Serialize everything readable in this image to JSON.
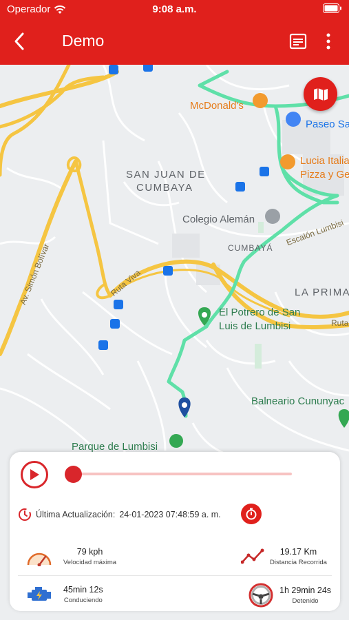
{
  "statusbar": {
    "carrier": "Operador",
    "time": "9:08 a.m."
  },
  "header": {
    "title": "Demo"
  },
  "map": {
    "labels": {
      "mcdonalds": "McDonald's",
      "paseo": "Paseo Sa",
      "lucia_1": "Lucia Italia",
      "lucia_2": "Pizza y Ge",
      "san_juan_1": "SAN JUAN DE",
      "san_juan_2": "CUMBAYA",
      "colegio": "Colegio Alemán",
      "cumbaya": "CUMBAYÁ",
      "escalon": "Escalón Lumbisi",
      "la_prima": "LA PRIMA",
      "potrero_1": "El Potrero de San",
      "potrero_2": "Luis de Lumbisi",
      "ruta_viva_1": "Ruta Viva",
      "ruta_2": "Ruta",
      "simon_bolivar": "Av. Simón Bolívar",
      "balneario": "Balneario Cununyac",
      "parque": "Parque de Lumbisi"
    },
    "route_color": "#5fe0a8",
    "road_color": "#f5c542"
  },
  "player": {
    "progress": 0.0
  },
  "info": {
    "last_update_label": "Última Actualización:",
    "last_update_value": "24-01-2023 07:48:59 a. m."
  },
  "stats": {
    "max_speed": {
      "value": "79 kph",
      "label": "Velocidad máxima"
    },
    "distance": {
      "value": "19.17 Km",
      "label": "Distancia Recorrida"
    },
    "driving": {
      "value": "45min 12s",
      "label": "Conduciendo"
    },
    "stopped": {
      "value": "1h 29min 24s",
      "label": "Detenido"
    }
  },
  "colors": {
    "primary": "#e0201c",
    "accent": "#d9262b"
  }
}
